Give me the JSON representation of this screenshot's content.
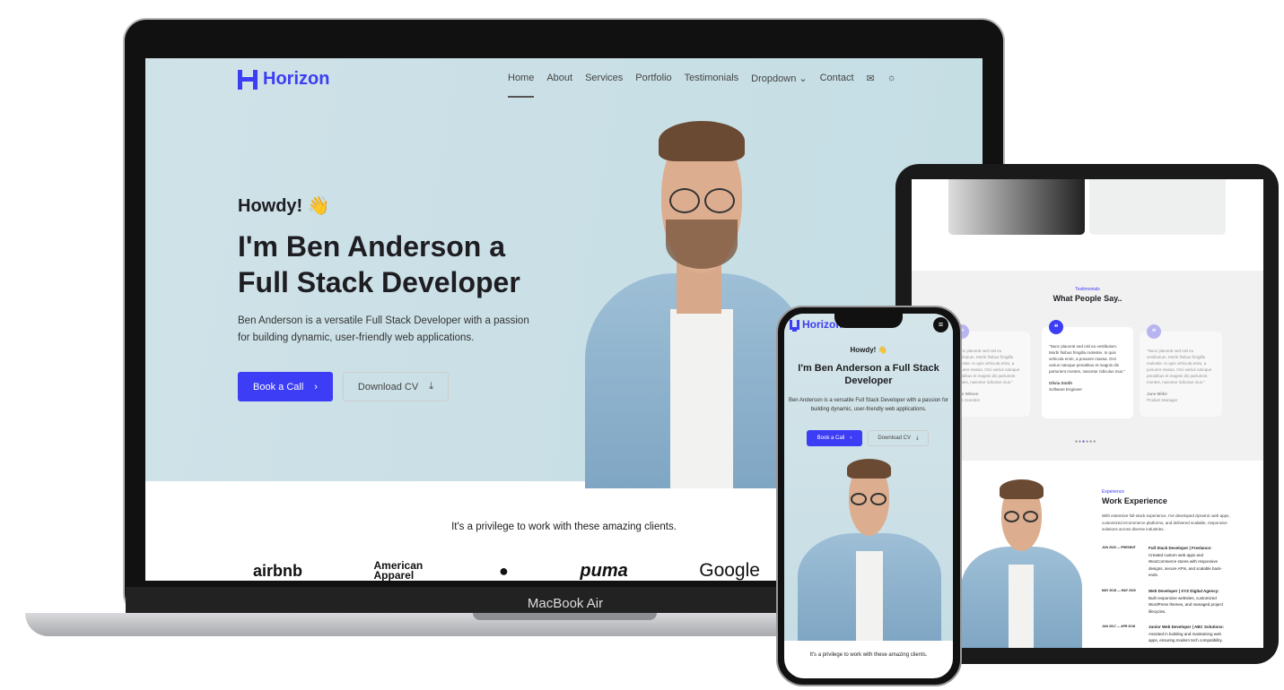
{
  "laptop": {
    "device_label": "MacBook Air",
    "brand": "Horizon",
    "nav": [
      "Home",
      "About",
      "Services",
      "Portfolio",
      "Testimonials",
      "Dropdown",
      "Contact"
    ],
    "nav_active": "Home",
    "greeting": "Howdy! 👋",
    "headline": "I'm Ben Anderson a Full Stack Developer",
    "lede": "Ben Anderson is a versatile Full Stack Developer with a passion for building dynamic, user-friendly web applications.",
    "book_call": "Book a Call",
    "download_cv": "Download CV",
    "clients_title": "It's a privilege to work with these amazing clients.",
    "clients": [
      "airbnb",
      "American Apparel",
      "",
      "puma",
      "Google"
    ]
  },
  "tablet": {
    "testimonials_kicker": "Testimonials",
    "testimonials_title": "What People Say..",
    "testimonials": [
      {
        "quote": "\"Nunc placerat sed nisl eu vestibulum. Morbi finibus fringilla molestie. In quis vehicula enim, a posuere massa. Orci varius natoque penatibus et magnis dis parturient montes, nascetur ridiculus mus.\"",
        "name": "Liam Wilson",
        "role": "Data Scientist"
      },
      {
        "quote": "\"Nunc placerat sed nisl eu vestibulum. Morbi finibus fringilla molestie. In quis vehicula enim, a posuere massa. Orci varius natoque penatibus et magnis dis parturient montes, nascetur ridiculus mus.\"",
        "name": "Olivia Smith",
        "role": "Software Engineer"
      },
      {
        "quote": "\"Nunc placerat sed nisl eu vestibulum. Morbi finibus fringilla molestie. In quis vehicula enim, a posuere massa. Orci varius natoque penatibus et magnis dis parturient montes, nascetur ridiculus mus.\"",
        "name": "Jane Miller",
        "role": "Product Manager"
      }
    ],
    "experience_kicker": "Experience",
    "experience_title": "Work Experience",
    "experience_intro": "With extensive full-stack experience, I've developed dynamic web apps, customized eCommerce platforms, and delivered scalable, responsive solutions across diverse industries.",
    "jobs": [
      {
        "dates": "JUN 2020 — PRESENT",
        "title": "Full Stack Developer | Freelance:",
        "desc": "Created custom web apps and WooCommerce stores with responsive designs, secure APIs, and scalable back-ends."
      },
      {
        "dates": "MAY 2018 — MAY 2020",
        "title": "Web Developer | XYZ Digital Agency:",
        "desc": "Built responsive websites, customized WordPress themes, and managed project lifecycles."
      },
      {
        "dates": "JAN 2017 — APR 2018",
        "title": "Junior Web Developer | ABC Solutions:",
        "desc": "Assisted in building and maintaining web apps, ensuring modern tech compatibility."
      }
    ]
  },
  "phone": {
    "brand": "Horizon",
    "greeting": "Howdy! 👋",
    "headline": "I'm Ben Anderson a Full Stack Developer",
    "lede": "Ben Anderson is a versatile Full Stack Developer with a passion for building dynamic, user-friendly web applications.",
    "book_call": "Book a Call",
    "download_cv": "Download CV",
    "clients_title": "It's a privilege to work with these amazing clients."
  },
  "colors": {
    "accent": "#3d3df5",
    "hero_bg": "#cfe2e8"
  }
}
